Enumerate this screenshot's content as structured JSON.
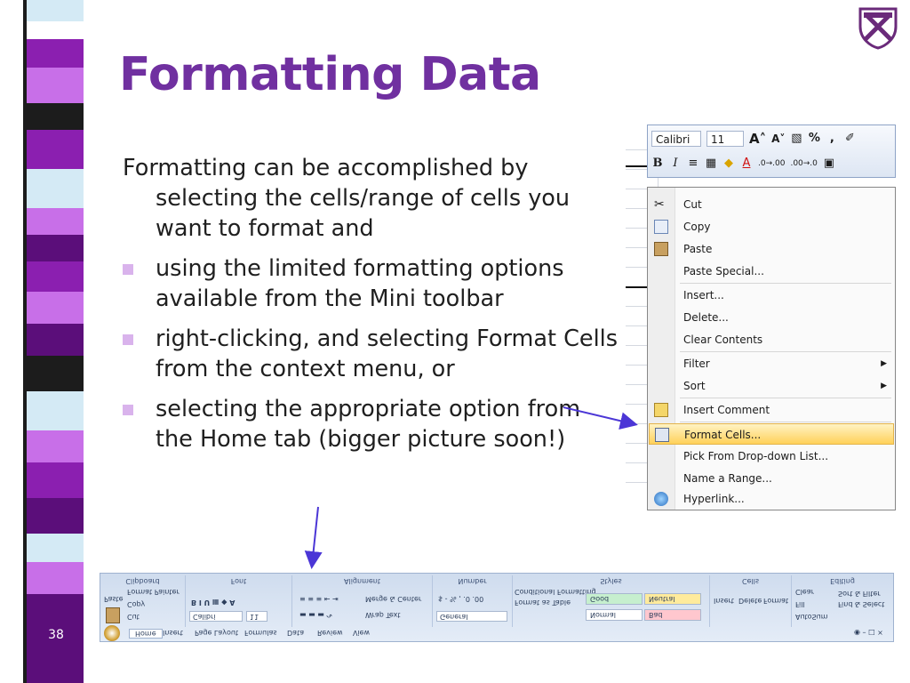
{
  "slide": {
    "title": "Formatting Data",
    "number": "38",
    "body": {
      "intro": "Formatting can be accomplished by selecting the cells/range of cells you want to format and",
      "bullets": [
        "using the limited formatting options available from the Mini toolbar",
        "right-clicking, and selecting Format Cells from the context menu, or",
        "selecting the appropriate option from the Home tab (bigger picture soon!)"
      ]
    },
    "colors": {
      "title": "#7030a0",
      "bullet": "#d9b3ec",
      "arrow": "#4b36d6",
      "stripe": [
        "#d4eaf5",
        "#8b1fb0",
        "#c86fe8",
        "#1c1c1c",
        "#ffffff",
        "#5b0e7a"
      ]
    }
  },
  "mini_toolbar": {
    "font_name": "Calibri",
    "font_size": "11",
    "grow_font": "A˄",
    "shrink_font": "A˅",
    "percent": "%",
    "comma": ",",
    "bold": "B",
    "italic": "I",
    "increase_decimal": ".0→.00",
    "decrease_decimal": ".00→.0"
  },
  "context_menu": {
    "items": [
      {
        "label": "Cut",
        "icon": "scissors-icon"
      },
      {
        "label": "Copy",
        "icon": "copy-icon"
      },
      {
        "label": "Paste",
        "icon": "paste-icon"
      },
      {
        "label": "Paste Special..."
      },
      {
        "label": "Insert..."
      },
      {
        "label": "Delete..."
      },
      {
        "label": "Clear Contents"
      },
      {
        "label": "Filter",
        "submenu": "▶"
      },
      {
        "label": "Sort",
        "submenu": "▶"
      },
      {
        "label": "Insert Comment",
        "icon": "comment-icon"
      },
      {
        "label": "Format Cells...",
        "icon": "format-cells-icon",
        "selected": true
      },
      {
        "label": "Pick From Drop-down List..."
      },
      {
        "label": "Name a Range..."
      },
      {
        "label": "Hyperlink...",
        "icon": "hyperlink-icon"
      }
    ]
  },
  "ribbon": {
    "groups": {
      "clipboard": "Clipboard",
      "font": "Font",
      "alignment": "Alignment",
      "number": "Number",
      "styles": "Styles",
      "cells": "Cells",
      "editing": "Editing"
    },
    "clipboard": {
      "paste": "Paste",
      "cut": "Cut",
      "copy": "Copy",
      "format_painter": "Format Painter"
    },
    "font": {
      "name": "Calibri",
      "size": "11"
    },
    "alignment": {
      "wrap_text": "Wrap Text",
      "merge_center": "Merge & Center"
    },
    "number": {
      "format": "General"
    },
    "styles": {
      "conditional_formatting": "Conditional Formatting",
      "format_as_table": "Format as Table",
      "normal": "Normal",
      "bad": "Bad",
      "good": "Good",
      "neutral": "Neutral"
    },
    "cells": {
      "insert": "Insert",
      "delete": "Delete",
      "format": "Format"
    },
    "editing": {
      "autosum": "AutoSum",
      "fill": "Fill",
      "clear": "Clear",
      "sort_filter": "Sort & Filter",
      "find_select": "Find & Select"
    },
    "tabs": [
      "Home",
      "Insert",
      "Page Layout",
      "Formulas",
      "Data",
      "Review",
      "View"
    ]
  }
}
